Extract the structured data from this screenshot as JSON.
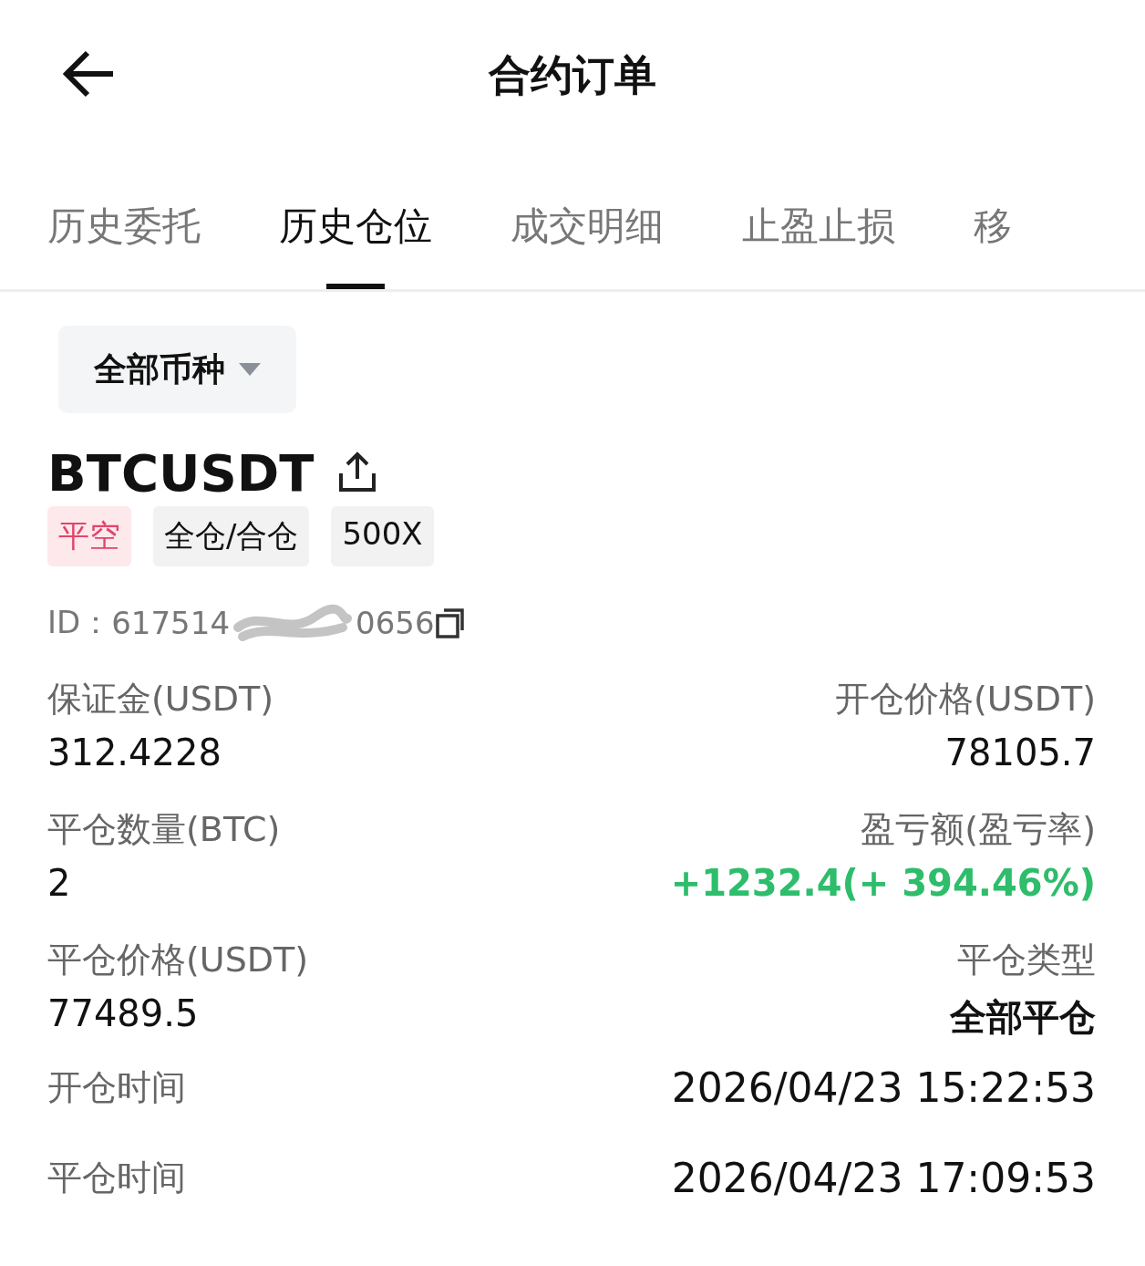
{
  "header": {
    "title": "合约订单"
  },
  "tabs": [
    {
      "label": "历史委托",
      "selected": false
    },
    {
      "label": "历史仓位",
      "selected": true
    },
    {
      "label": "成交明细",
      "selected": false
    },
    {
      "label": "止盈止损",
      "selected": false
    },
    {
      "label": "移",
      "selected": false
    }
  ],
  "filter": {
    "label": "全部币种"
  },
  "position": {
    "symbol": "BTCUSDT",
    "tags": [
      {
        "label": "平空",
        "kind": "side"
      },
      {
        "label": "全仓/合仓",
        "kind": "plain"
      },
      {
        "label": "500X",
        "kind": "plain"
      }
    ],
    "id_label": "ID：",
    "id_start": "617514",
    "id_end": "0656",
    "fields": [
      {
        "label": "保证金(USDT)",
        "value": "312.4228",
        "kind": "plain"
      },
      {
        "label": "开仓价格(USDT)",
        "value": "78105.7",
        "kind": "plain"
      },
      {
        "label": "平仓数量(BTC)",
        "value": "2",
        "kind": "plain"
      },
      {
        "label": "盈亏额(盈亏率)",
        "value": "+1232.4(+ 394.46%)",
        "kind": "profit"
      },
      {
        "label": "平仓价格(USDT)",
        "value": "77489.5",
        "kind": "plain"
      },
      {
        "label": "平仓类型",
        "value": "全部平仓",
        "kind": "emphasis"
      }
    ],
    "times": [
      {
        "label": "开仓时间",
        "value": "2026/04/23 15:22:53"
      },
      {
        "label": "平仓时间",
        "value": "2026/04/23 17:09:53"
      }
    ]
  }
}
